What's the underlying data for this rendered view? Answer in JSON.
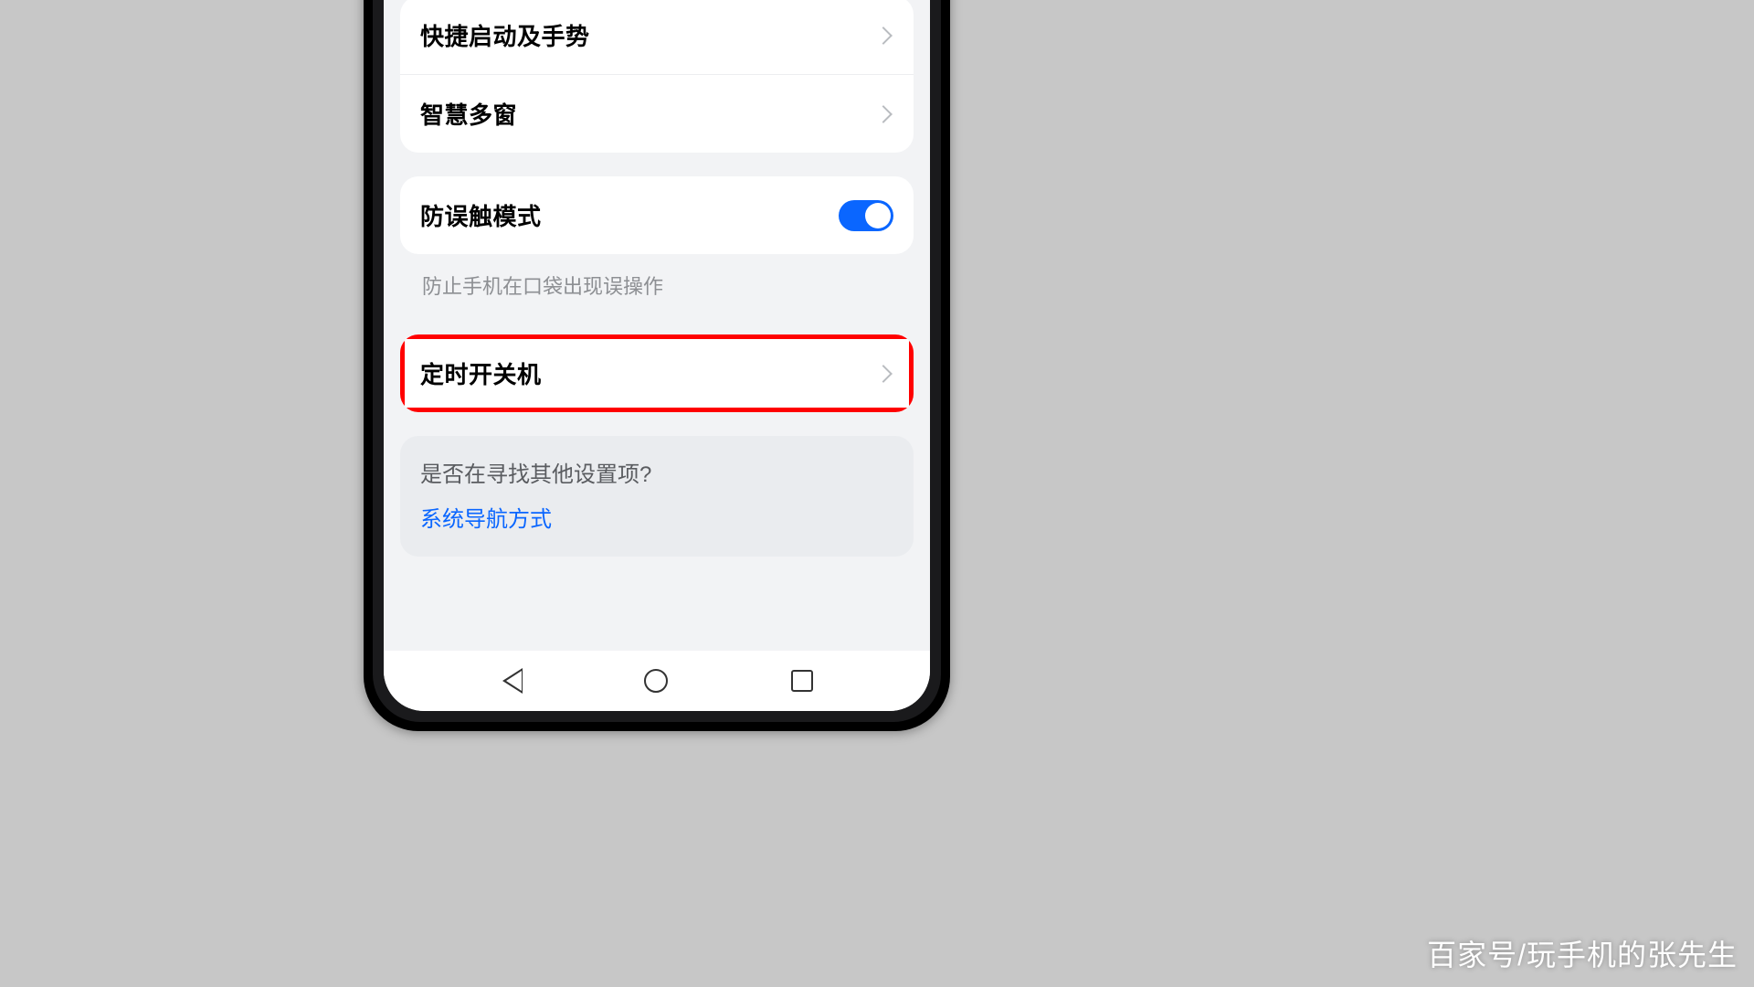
{
  "settings": {
    "group_top": {
      "shortcut_gestures": "快捷启动及手势",
      "smart_multiwindow": "智慧多窗"
    },
    "mistouch": {
      "label": "防误触模式",
      "enabled": true,
      "helper": "防止手机在口袋出现误操作"
    },
    "scheduled_power": {
      "label": "定时开关机"
    },
    "suggest": {
      "question": "是否在寻找其他设置项?",
      "link": "系统导航方式"
    }
  },
  "watermark": "百家号/玩手机的张先生"
}
